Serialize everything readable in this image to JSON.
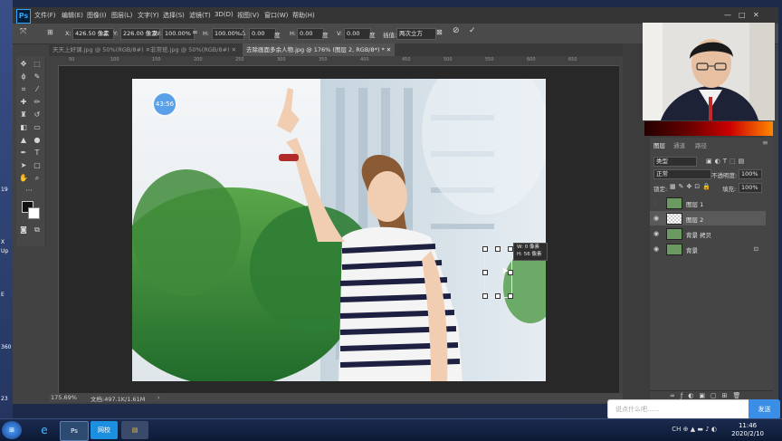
{
  "desktop": {
    "left_labels": [
      "19",
      "X",
      "Up",
      "E",
      "360",
      "23"
    ]
  },
  "app": {
    "logo": "Ps",
    "menu": [
      "文件(F)",
      "编辑(E)",
      "图像(I)",
      "图层(L)",
      "文字(Y)",
      "选择(S)",
      "滤镜(T)",
      "3D(D)",
      "视图(V)",
      "窗口(W)",
      "帮助(H)"
    ],
    "window_controls": [
      "—",
      "□",
      "✕"
    ]
  },
  "options": {
    "x_label": "X:",
    "x_value": "426.50 像素",
    "y_label": "Y:",
    "y_value": "226.00 像素",
    "w_label": "W:",
    "w_value": "100.00%",
    "h_label": "H:",
    "h_value": "100.00%",
    "angle_value": "0.00",
    "angle_unit": "度",
    "hskew_label": "H:",
    "hskew_value": "0.00",
    "hskew_unit": "度",
    "vskew_label": "V:",
    "vskew_value": "0.00",
    "vskew_unit": "度",
    "interp_label": "插值:",
    "interp_value": "两次立方",
    "cancel_glyph": "⊘",
    "commit_glyph": "✓"
  },
  "tabs": [
    {
      "label": "天天上好课.jpg @ 50%(RGB/8#)",
      "close": "✕"
    },
    {
      "label": "非常班.jpg @ 50%(RGB/8#)",
      "close": "✕"
    },
    {
      "label": "去除画面多余人物.jpg @ 176% (图层 2, RGB/8*) *",
      "close": "✕"
    }
  ],
  "ruler_ticks": [
    "50",
    "100",
    "150",
    "200",
    "250",
    "300",
    "350",
    "400",
    "450",
    "500",
    "550",
    "600",
    "650"
  ],
  "canvas": {
    "timer": "43:56",
    "size_tip_w": "W: 0 像素",
    "size_tip_h": "H: 56 像素"
  },
  "status": {
    "zoom": "175.69%",
    "doc": "文档:497.1K/1.61M",
    "arrow": "›"
  },
  "layers_panel": {
    "tabs": [
      "图层",
      "通道",
      "路径"
    ],
    "filter_label": "类型",
    "blend_mode": "正常",
    "opacity_label": "不透明度:",
    "opacity_value": "100%",
    "lock_label": "锁定:",
    "fill_label": "填充:",
    "fill_value": "100%",
    "layers": [
      {
        "name": "图层 1",
        "visible": false,
        "locked": false,
        "thumb": "photo"
      },
      {
        "name": "图层 2",
        "visible": true,
        "locked": false,
        "thumb": "check"
      },
      {
        "name": "背景 拷贝",
        "visible": true,
        "locked": false,
        "thumb": "photo"
      },
      {
        "name": "背景",
        "visible": true,
        "locked": true,
        "thumb": "photo"
      }
    ]
  },
  "chat": {
    "placeholder": "说点什么吧......",
    "send": "发送"
  },
  "taskbar": {
    "apps": [
      "Ps",
      "网校",
      "▤"
    ],
    "tray": "CH ⊕ ▲ ▬ ♪ ◐",
    "time": "11:46",
    "date": "2020/2/10"
  },
  "colors": {
    "ps_blue": "#31a8ff",
    "send_button": "#3a8ee6",
    "timer_badge": "#5aa0e8"
  }
}
